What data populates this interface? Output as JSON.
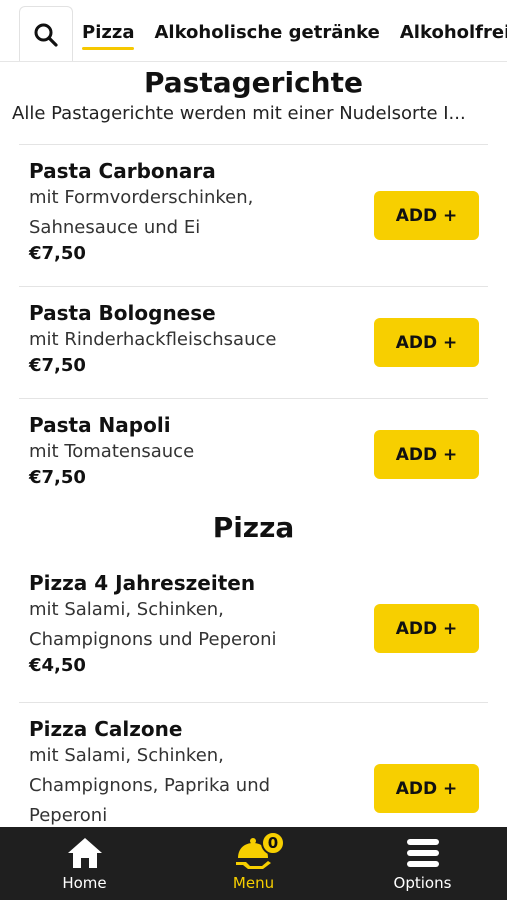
{
  "header": {
    "search_icon": "search-icon",
    "tabs": [
      "Pizza",
      "Alkoholische getränke",
      "Alkoholfreie"
    ],
    "active_tab": "Pizza"
  },
  "sections": [
    {
      "title": "Pastagerichte",
      "description": "Alle Pastagerichte werden mit einer Nudelsorte I...",
      "items": [
        {
          "name": "Pasta Carbonara",
          "description": "mit Formvorderschinken, Sahnesauce und Ei",
          "price": "€7,50",
          "button": "ADD +"
        },
        {
          "name": "Pasta Bolognese",
          "description": "mit Rinderhackfleischsauce",
          "price": "€7,50",
          "button": "ADD +"
        },
        {
          "name": "Pasta Napoli",
          "description": "mit Tomatensauce",
          "price": "€7,50",
          "button": "ADD +"
        }
      ]
    },
    {
      "title": "Pizza",
      "items": [
        {
          "name": "Pizza 4 Jahreszeiten",
          "description": "mit Salami, Schinken, Champignons und Peperoni",
          "price": "€4,50",
          "button": "ADD +"
        },
        {
          "name": "Pizza Calzone",
          "description": "mit Salami, Schinken, Champignons, Paprika und Peperoni",
          "price": "",
          "button": "ADD +"
        }
      ]
    }
  ],
  "bottom_nav": {
    "items": [
      {
        "label": "Home",
        "icon": "home-icon"
      },
      {
        "label": "Menu",
        "icon": "cloche-icon",
        "badge": "0"
      },
      {
        "label": "Options",
        "icon": "menu-bars-icon"
      }
    ]
  },
  "colors": {
    "accent": "#f7cf00",
    "nav_bg": "#1f1f1f"
  }
}
